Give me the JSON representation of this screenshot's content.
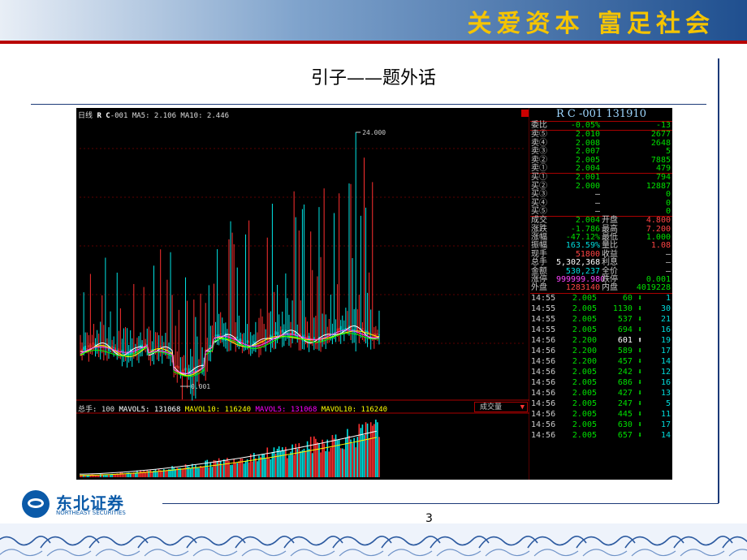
{
  "slide": {
    "banner_text": "关爱资本  富足社会",
    "title": "引子——题外话",
    "page_number": "3",
    "logo": {
      "cn": "东北证券",
      "en": "NORTHEAST SECURITIES"
    }
  },
  "colors": {
    "banner": "#1f4f8f",
    "banner_text": "#f5c400",
    "accent_red": "#b80000",
    "rule": "#1c3a78"
  },
  "kline": {
    "period": "日线",
    "name": "R C",
    "code_suffix": "-001",
    "ma5_label": "MA5: 2.106",
    "ma10_label": "MA10: 2.446",
    "max_label": "24.000",
    "min_label": "0.001"
  },
  "volume": {
    "hand_label": "总手: 100",
    "mavol5_label": "MAVOL5: 131068",
    "mavol10_label": "MAVOL10: 116240",
    "mavol5b_label": "MAVOL5: 131068",
    "mavol10b_label": "MAVOL10: 116240",
    "selector": "成交量"
  },
  "quote": {
    "title": "R C -001 131910",
    "weibi": {
      "label": "委比",
      "pct": "-0.05%",
      "diff": "-13"
    },
    "asks": [
      {
        "label": "卖⑤",
        "price": "2.010",
        "vol": "2677"
      },
      {
        "label": "卖④",
        "price": "2.008",
        "vol": "2648"
      },
      {
        "label": "卖③",
        "price": "2.007",
        "vol": "5"
      },
      {
        "label": "卖②",
        "price": "2.005",
        "vol": "7885"
      },
      {
        "label": "卖①",
        "price": "2.004",
        "vol": "479"
      }
    ],
    "bids": [
      {
        "label": "买①",
        "price": "2.001",
        "vol": "794"
      },
      {
        "label": "买②",
        "price": "2.000",
        "vol": "12887"
      },
      {
        "label": "买③",
        "price": "–",
        "vol": "0"
      },
      {
        "label": "买④",
        "price": "–",
        "vol": "0"
      },
      {
        "label": "买⑤",
        "price": "–",
        "vol": "0"
      }
    ],
    "stats": [
      {
        "l1": "成交",
        "v1": "2.004",
        "c1": "g",
        "l2": "开盘",
        "v2": "4.800",
        "c2": "r"
      },
      {
        "l1": "涨跌",
        "v1": "-1.786",
        "c1": "g",
        "l2": "最高",
        "v2": "7.200",
        "c2": "r"
      },
      {
        "l1": "涨幅",
        "v1": "-47.12%",
        "c1": "g",
        "l2": "最低",
        "v2": "1.000",
        "c2": "g"
      },
      {
        "l1": "振幅",
        "v1": "163.59%",
        "c1": "c",
        "l2": "量比",
        "v2": "1.08",
        "c2": "r"
      },
      {
        "l1": "现手",
        "v1": "51800",
        "c1": "r",
        "l2": "收益",
        "v2": "–",
        "c2": "gr"
      },
      {
        "l1": "总手",
        "v1": "5,302,368",
        "c1": "w",
        "l2": "利息",
        "v2": "–",
        "c2": "gr"
      },
      {
        "l1": "金额",
        "v1": "530,237",
        "c1": "c",
        "l2": "全价",
        "v2": "–",
        "c2": "gr"
      },
      {
        "l1": "涨停",
        "v1": "999999.980",
        "c1": "m",
        "l2": "跌停",
        "v2": "0.001",
        "c2": "g"
      },
      {
        "l1": "外盘",
        "v1": "1283140",
        "c1": "r",
        "l2": "内盘",
        "v2": "4019228",
        "c2": "g"
      }
    ],
    "ticks": [
      {
        "time": "14:55",
        "price": "2.005",
        "vol": "60",
        "dir": "down",
        "cnt": "1"
      },
      {
        "time": "14:55",
        "price": "2.005",
        "vol": "1130",
        "dir": "down",
        "cnt": "30"
      },
      {
        "time": "14:55",
        "price": "2.005",
        "vol": "537",
        "dir": "down",
        "cnt": "21"
      },
      {
        "time": "14:55",
        "price": "2.005",
        "vol": "694",
        "dir": "down",
        "cnt": "16"
      },
      {
        "time": "14:56",
        "price": "2.200",
        "vol": "601",
        "dir": "up",
        "cnt": "19"
      },
      {
        "time": "14:56",
        "price": "2.200",
        "vol": "589",
        "dir": "down",
        "cnt": "17"
      },
      {
        "time": "14:56",
        "price": "2.200",
        "vol": "457",
        "dir": "down",
        "cnt": "14"
      },
      {
        "time": "14:56",
        "price": "2.005",
        "vol": "242",
        "dir": "down",
        "cnt": "12"
      },
      {
        "time": "14:56",
        "price": "2.005",
        "vol": "686",
        "dir": "down",
        "cnt": "16"
      },
      {
        "time": "14:56",
        "price": "2.005",
        "vol": "427",
        "dir": "down",
        "cnt": "13"
      },
      {
        "time": "14:56",
        "price": "2.005",
        "vol": "247",
        "dir": "down",
        "cnt": "5"
      },
      {
        "time": "14:56",
        "price": "2.005",
        "vol": "445",
        "dir": "down",
        "cnt": "11"
      },
      {
        "time": "14:56",
        "price": "2.005",
        "vol": "630",
        "dir": "down",
        "cnt": "17"
      },
      {
        "time": "14:56",
        "price": "2.005",
        "vol": "657",
        "dir": "down",
        "cnt": "14"
      }
    ]
  }
}
